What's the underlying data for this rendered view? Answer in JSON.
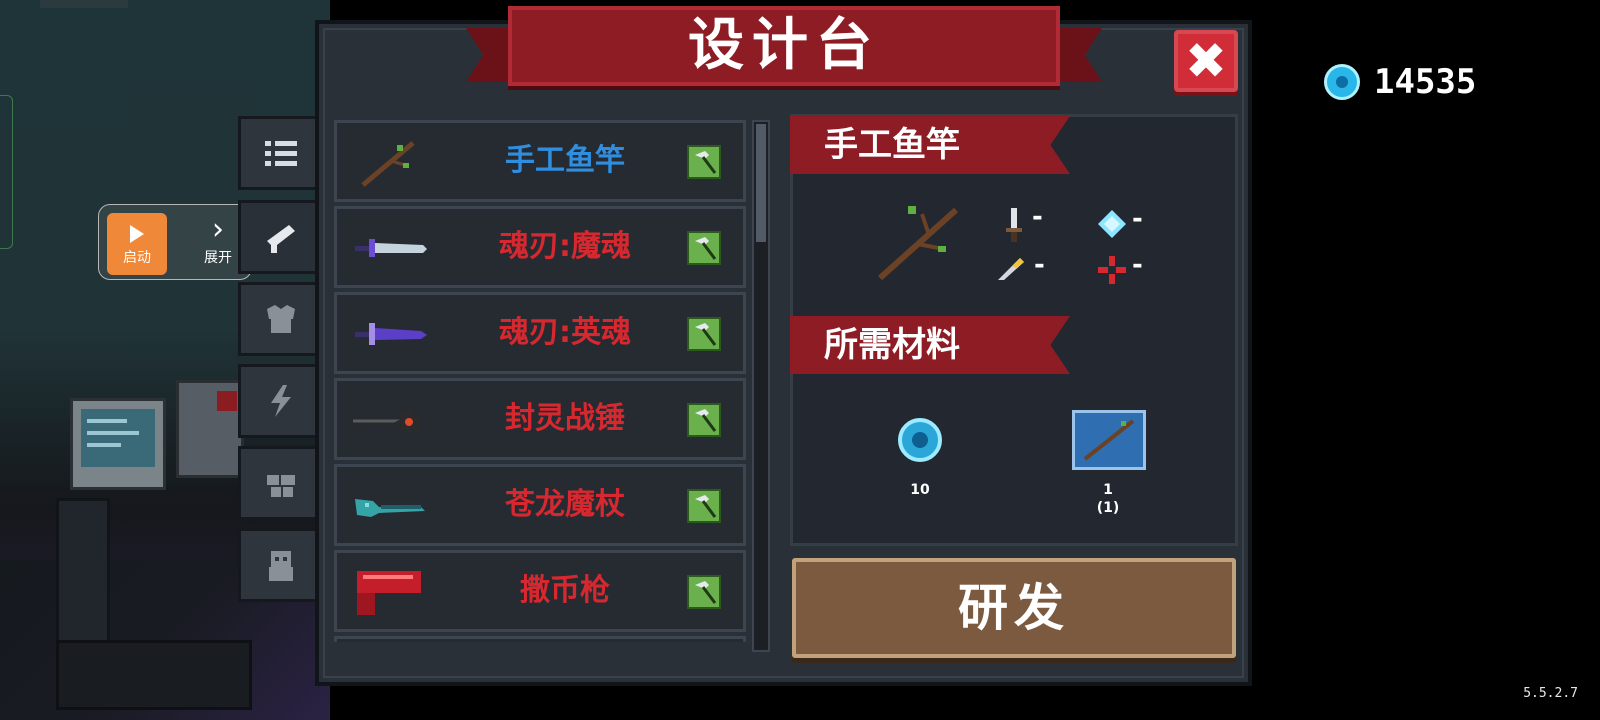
{
  "title": "设计台",
  "coins": "14535",
  "version": "5.5.2.7",
  "plugin_widget": {
    "start_label": "启动",
    "expand_label": "展开"
  },
  "categories": [
    {
      "icon": "list-icon",
      "active": false
    },
    {
      "icon": "weapon-icon",
      "active": true
    },
    {
      "icon": "armor-icon",
      "active": false
    },
    {
      "icon": "lightning-icon",
      "active": false
    },
    {
      "icon": "materials-icon",
      "active": false
    },
    {
      "icon": "character-icon",
      "active": false
    }
  ],
  "items": [
    {
      "name": "手工鱼竿",
      "color": "#2f8ee0",
      "icon": "fishing-rod-icon"
    },
    {
      "name": "魂刃:魔魂",
      "color": "#d7282f",
      "icon": "purple-sword-icon"
    },
    {
      "name": "魂刃:英魂",
      "color": "#d7282f",
      "icon": "purple-blade-icon"
    },
    {
      "name": "封灵战锤",
      "color": "#d7282f",
      "icon": "war-hammer-icon"
    },
    {
      "name": "苍龙魔杖",
      "color": "#d7282f",
      "icon": "dragon-staff-icon"
    },
    {
      "name": "撒币枪",
      "color": "#d7282f",
      "icon": "coin-gun-icon"
    }
  ],
  "detail": {
    "selected_name": "手工鱼竿",
    "stats": {
      "attack": "-",
      "energy": "-",
      "crit": "-",
      "accuracy": "-"
    },
    "materials_heading": "所需材料",
    "materials": [
      {
        "icon": "gem-icon",
        "count": "10",
        "owned": ""
      },
      {
        "icon": "blueprint-icon",
        "count": "1",
        "owned": "(1)"
      }
    ]
  },
  "research_label": "研发",
  "colors": {
    "banner": "#8e1c24",
    "panel": "#2a3038",
    "button": "#7c5a40",
    "rare": "#d7282f",
    "common": "#2f8ee0"
  }
}
